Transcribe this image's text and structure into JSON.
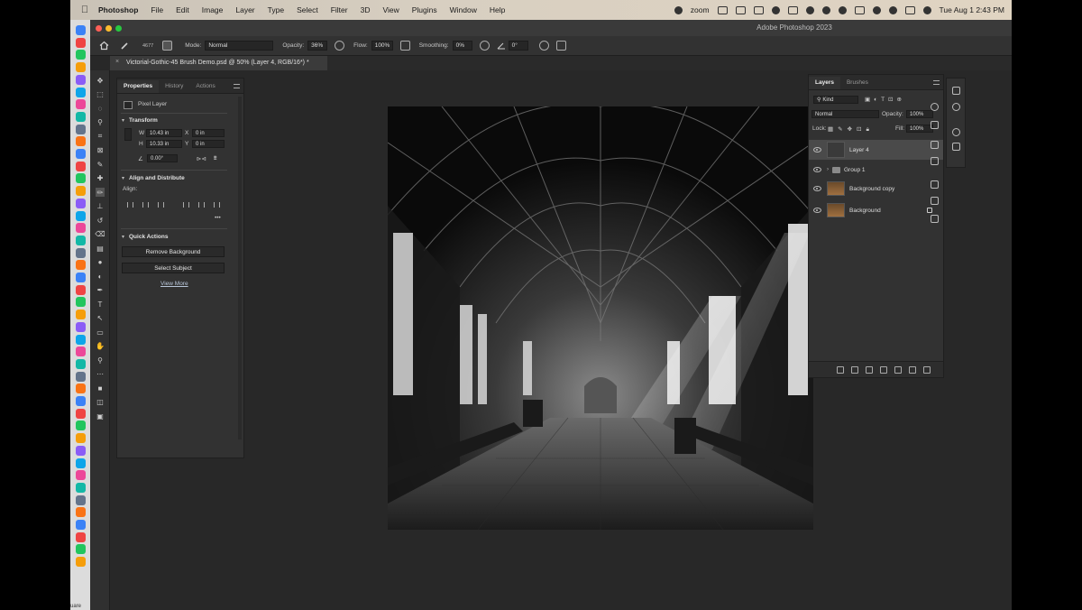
{
  "menubar": {
    "app_name": "Photoshop",
    "items": [
      "File",
      "Edit",
      "Image",
      "Layer",
      "Type",
      "Select",
      "Filter",
      "3D",
      "View",
      "Plugins",
      "Window",
      "Help"
    ],
    "zoom_label": "zoom",
    "clock": "Tue Aug 1  2:43 PM"
  },
  "window": {
    "title": "Adobe Photoshop 2023"
  },
  "options_bar": {
    "brush_size": "4677",
    "mode_label": "Mode:",
    "mode_value": "Normal",
    "opacity_label": "Opacity:",
    "opacity_value": "36%",
    "flow_label": "Flow:",
    "flow_value": "100%",
    "smoothing_label": "Smoothing:",
    "smoothing_value": "0%",
    "angle_value": "0°"
  },
  "document_tab": {
    "title": "Victorial-Gothic-45 Brush Demo.psd @ 50% (Layer 4, RGB/16*) *"
  },
  "properties_panel": {
    "tabs": [
      "Properties",
      "History",
      "Actions"
    ],
    "layer_kind": "Pixel Layer",
    "transform": {
      "title": "Transform",
      "w_label": "W",
      "w_value": "10.43 in",
      "h_label": "H",
      "h_value": "10.33 in",
      "x_label": "X",
      "x_value": "0 in",
      "y_label": "Y",
      "y_value": "0 in",
      "angle_value": "0.00°"
    },
    "align": {
      "title": "Align and Distribute",
      "align_label": "Align:"
    },
    "quick_actions": {
      "title": "Quick Actions",
      "remove_background": "Remove Background",
      "select_subject": "Select Subject",
      "view_more": "View More"
    }
  },
  "layers_panel": {
    "tabs": [
      "Layers",
      "Brushes"
    ],
    "filter_kind": "Kind",
    "blend_mode": "Normal",
    "opacity_label": "Opacity:",
    "opacity_value": "100%",
    "lock_label": "Lock:",
    "fill_label": "Fill:",
    "fill_value": "100%",
    "layers": [
      {
        "name": "Layer 4",
        "selected": true
      },
      {
        "name": "Group 1",
        "type": "group"
      },
      {
        "name": "Background copy"
      },
      {
        "name": "Background",
        "locked": true
      }
    ]
  },
  "colors": {
    "app_bg": "#282828",
    "panel_bg": "#323232",
    "selected_row": "#4a4a4a"
  }
}
